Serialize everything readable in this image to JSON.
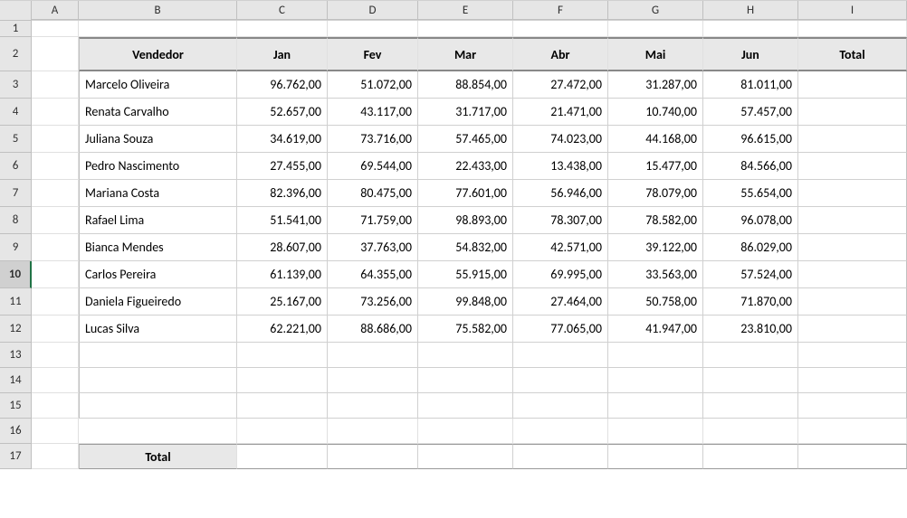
{
  "columns": [
    "A",
    "B",
    "C",
    "D",
    "E",
    "F",
    "G",
    "H",
    "I"
  ],
  "rows": [
    "1",
    "2",
    "3",
    "4",
    "5",
    "6",
    "7",
    "8",
    "9",
    "10",
    "11",
    "12",
    "13",
    "14",
    "15",
    "16",
    "17"
  ],
  "selectedRow": "10",
  "table": {
    "header_vendedor": "Vendedor",
    "header_jan": "Jan",
    "header_fev": "Fev",
    "header_mar": "Mar",
    "header_abr": "Abr",
    "header_mai": "Mai",
    "header_jun": "Jun",
    "header_total": "Total",
    "total_label": "Total",
    "rows": [
      {
        "name": "Marcelo Oliveira",
        "jan": "96.762,00",
        "fev": "51.072,00",
        "mar": "88.854,00",
        "abr": "27.472,00",
        "mai": "31.287,00",
        "jun": "81.011,00"
      },
      {
        "name": "Renata Carvalho",
        "jan": "52.657,00",
        "fev": "43.117,00",
        "mar": "31.717,00",
        "abr": "21.471,00",
        "mai": "10.740,00",
        "jun": "57.457,00"
      },
      {
        "name": "Juliana Souza",
        "jan": "34.619,00",
        "fev": "73.716,00",
        "mar": "57.465,00",
        "abr": "74.023,00",
        "mai": "44.168,00",
        "jun": "96.615,00"
      },
      {
        "name": "Pedro Nascimento",
        "jan": "27.455,00",
        "fev": "69.544,00",
        "mar": "22.433,00",
        "abr": "13.438,00",
        "mai": "15.477,00",
        "jun": "84.566,00"
      },
      {
        "name": "Mariana Costa",
        "jan": "82.396,00",
        "fev": "80.475,00",
        "mar": "77.601,00",
        "abr": "56.946,00",
        "mai": "78.079,00",
        "jun": "55.654,00"
      },
      {
        "name": "Rafael Lima",
        "jan": "51.541,00",
        "fev": "71.759,00",
        "mar": "98.893,00",
        "abr": "78.307,00",
        "mai": "78.582,00",
        "jun": "96.078,00"
      },
      {
        "name": "Bianca Mendes",
        "jan": "28.607,00",
        "fev": "37.763,00",
        "mar": "54.832,00",
        "abr": "42.571,00",
        "mai": "39.122,00",
        "jun": "86.029,00"
      },
      {
        "name": "Carlos Pereira",
        "jan": "61.139,00",
        "fev": "64.355,00",
        "mar": "55.915,00",
        "abr": "69.995,00",
        "mai": "33.563,00",
        "jun": "57.524,00"
      },
      {
        "name": "Daniela Figueiredo",
        "jan": "25.167,00",
        "fev": "73.256,00",
        "mar": "99.848,00",
        "abr": "27.464,00",
        "mai": "50.758,00",
        "jun": "71.870,00"
      },
      {
        "name": "Lucas Silva",
        "jan": "62.221,00",
        "fev": "88.686,00",
        "mar": "75.582,00",
        "abr": "77.065,00",
        "mai": "41.947,00",
        "jun": "23.810,00"
      }
    ]
  }
}
